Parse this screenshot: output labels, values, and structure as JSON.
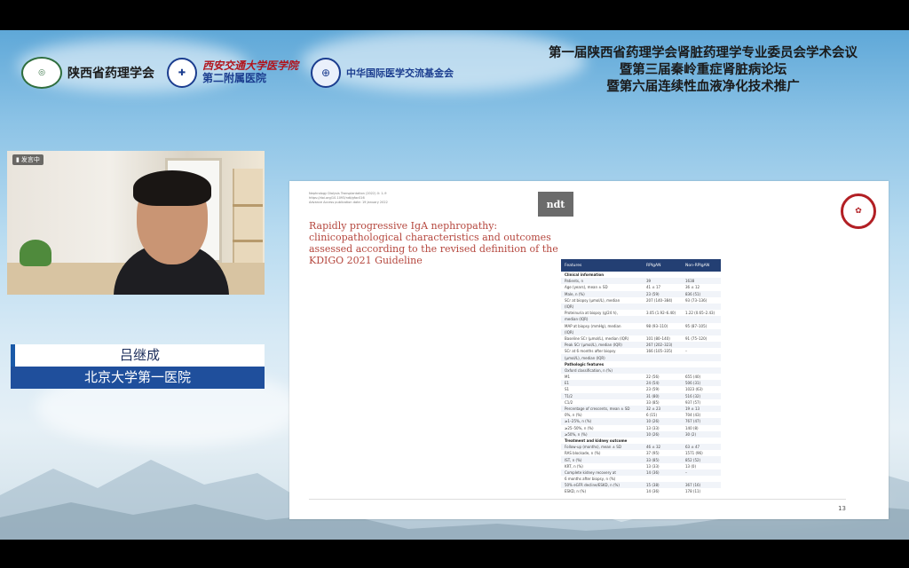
{
  "conference": {
    "title_lines": [
      "第一届陕西省药理学会肾脏药理学专业委员会学术会议",
      "暨第三届秦岭重症肾脏病论坛",
      "暨第六届连续性血液净化技术推广"
    ]
  },
  "logos": {
    "pharm_society": "陕西省药理学会",
    "xjtu_line1": "西安交通大学医学院",
    "xjtu_line2": "第二附属医院",
    "foundation": "中华国际医学交流基金会",
    "icon_names": [
      "society-emblem-icon",
      "xjtu-seal-icon",
      "foundation-globe-icon"
    ]
  },
  "video": {
    "badge": "发言中",
    "icon": "microphone-icon"
  },
  "speaker": {
    "name": "吕继成",
    "organization": "北京大学第一医院"
  },
  "slide": {
    "journal_lines": [
      "Nephrology Dialysis Transplantation (2022) 0: 1–9",
      "https://doi.org/10.1093/ndt/gfac016",
      "Advance Access publication date: 19 January 2022"
    ],
    "journal_logo": "ndt",
    "paper_title": "Rapidly progressive IgA nephropathy: clinicopathological characteristics and outcomes assessed according to the revised definition of the KDIGO 2021 Guideline",
    "page_number": "13",
    "emblem_icon": "university-emblem-icon",
    "table": {
      "headers": [
        "Features",
        "RPIgAN",
        "Non-RPIgAN"
      ],
      "rows": [
        {
          "f": "Clinical information",
          "a": "",
          "b": "",
          "sec": true
        },
        {
          "f": "Patients, n",
          "a": "39",
          "b": "1638"
        },
        {
          "f": "Age (years), mean ± SD",
          "a": "41 ± 17",
          "b": "36 ± 12"
        },
        {
          "f": "Male, n (%)",
          "a": "23 (59)",
          "b": "836 (51)"
        },
        {
          "f": "SCr at biopsy (μmol/L), median",
          "a": "207 (140–384)",
          "b": "93 (73–136)"
        },
        {
          "f": "(IQR)",
          "a": "",
          "b": ""
        },
        {
          "f": "Proteinuria at biopsy (g/24 h),",
          "a": "3.05 (1.92–6.40)",
          "b": "1.22 (0.65–2.43)"
        },
        {
          "f": "median (IQR)",
          "a": "",
          "b": ""
        },
        {
          "f": "MAP at biopsy (mmHg), median",
          "a": "98 (93–110)",
          "b": "95 (87–105)"
        },
        {
          "f": "(IQR)",
          "a": "",
          "b": ""
        },
        {
          "f": "Baseline SCr (μmol/L), median (IQR)",
          "a": "101 (80–140)",
          "b": "91 (75–120)"
        },
        {
          "f": "Peak SCr (μmol/L), median (IQR)",
          "a": "267 (202–323)",
          "b": ""
        },
        {
          "f": "SCr at 6 months after biopsy",
          "a": "166 (105–335)",
          "b": "–"
        },
        {
          "f": "(μmol/L), median (IQR)",
          "a": "",
          "b": ""
        },
        {
          "f": "Pathologic features",
          "a": "",
          "b": "",
          "sec": true
        },
        {
          "f": "Oxford classification, n (%)",
          "a": "",
          "b": ""
        },
        {
          "f": "M1",
          "a": "22 (56)",
          "b": "655 (40)"
        },
        {
          "f": "E1",
          "a": "24 (54)",
          "b": "506 (31)"
        },
        {
          "f": "S1",
          "a": "23 (59)",
          "b": "1023 (63)"
        },
        {
          "f": "T1/2",
          "a": "31 (80)",
          "b": "516 (32)"
        },
        {
          "f": "C1/2",
          "a": "33 (85)",
          "b": "937 (57)"
        },
        {
          "f": "Percentage of crescents, mean ± SD",
          "a": "32 ± 23",
          "b": "19 ± 13"
        },
        {
          "f": "0%, n (%)",
          "a": "6 (15)",
          "b": "704 (43)"
        },
        {
          "f": "≥1–25%, n (%)",
          "a": "10 (26)",
          "b": "767 (47)"
        },
        {
          "f": "≥25–50%, n (%)",
          "a": "13 (33)",
          "b": "140 (8)"
        },
        {
          "f": "≥50%, n (%)",
          "a": "10 (26)",
          "b": "30 (2)"
        },
        {
          "f": "Treatment and kidney outcome",
          "a": "",
          "b": "",
          "sec": true
        },
        {
          "f": "Follow-up (months), mean ± SD",
          "a": "46 ± 32",
          "b": "63 ± 47"
        },
        {
          "f": "RAS blockade, n (%)",
          "a": "37 (95)",
          "b": "1571 (96)"
        },
        {
          "f": "IST, n (%)",
          "a": "33 (85)",
          "b": "852 (52)"
        },
        {
          "f": "KRT, n (%)",
          "a": "13 (33)",
          "b": "13 (0)"
        },
        {
          "f": "Complete kidney recovery at",
          "a": "14 (36)",
          "b": "–"
        },
        {
          "f": "6 months after biopsy, n (%)",
          "a": "",
          "b": ""
        },
        {
          "f": "50% eGFR decline/ESKD, n (%)",
          "a": "15 (38)",
          "b": "367 (16)"
        },
        {
          "f": "ESKD, n (%)",
          "a": "14 (36)",
          "b": "178 (11)"
        }
      ]
    }
  },
  "colors": {
    "accent_blue": "#1f4f9c",
    "table_header": "#233f73",
    "paper_title": "#b5473e",
    "emblem_red": "#b21f24"
  }
}
